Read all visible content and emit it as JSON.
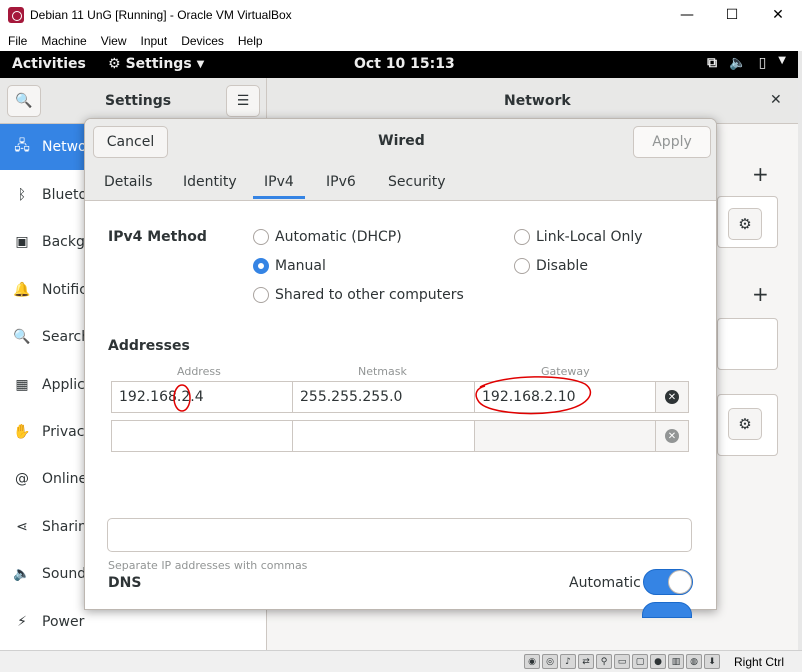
{
  "host": {
    "window_title": "Debian 11 UnG [Running] - Oracle VM VirtualBox",
    "controls": {
      "minimize": "—",
      "maximize": "☐",
      "close": "✕"
    },
    "menu": [
      "File",
      "Machine",
      "View",
      "Input",
      "Devices",
      "Help"
    ],
    "status_right": "Right Ctrl"
  },
  "gnome": {
    "activities": "Activities",
    "app_menu": "Settings",
    "clock": "Oct 10  15:13",
    "tray": [
      "network-icon",
      "volume-icon",
      "battery-icon",
      "power-menu-icon"
    ]
  },
  "settings": {
    "title": "Settings",
    "panel_title": "Network",
    "sidebar": [
      {
        "label": "Network",
        "icon": "network-icon",
        "active": true
      },
      {
        "label": "Bluetooth",
        "icon": "bluetooth-icon"
      },
      {
        "label": "Background",
        "icon": "background-icon"
      },
      {
        "label": "Notifications",
        "icon": "notifications-icon"
      },
      {
        "label": "Search",
        "icon": "search-icon"
      },
      {
        "label": "Applications",
        "icon": "applications-icon"
      },
      {
        "label": "Privacy",
        "icon": "privacy-icon"
      },
      {
        "label": "Online Accounts",
        "icon": "online-accounts-icon"
      },
      {
        "label": "Sharing",
        "icon": "sharing-icon"
      },
      {
        "label": "Sound",
        "icon": "sound-icon"
      },
      {
        "label": "Power",
        "icon": "power-icon"
      }
    ]
  },
  "dialog": {
    "cancel": "Cancel",
    "title": "Wired",
    "apply": "Apply",
    "tabs": [
      "Details",
      "Identity",
      "IPv4",
      "IPv6",
      "Security"
    ],
    "active_tab": "IPv4",
    "ipv4_method_label": "IPv4 Method",
    "methods": {
      "dhcp": "Automatic (DHCP)",
      "manual": "Manual",
      "shared": "Shared to other computers",
      "link_local": "Link-Local Only",
      "disable": "Disable"
    },
    "selected_method": "Manual",
    "addresses_label": "Addresses",
    "columns": [
      "Address",
      "Netmask",
      "Gateway"
    ],
    "rows": [
      {
        "address": "192.168.2.4",
        "netmask": "255.255.255.0",
        "gateway": "192.168.2.10"
      },
      {
        "address": "",
        "netmask": "",
        "gateway": ""
      }
    ],
    "dns_label": "DNS",
    "dns_automatic_label": "Automatic",
    "dns_automatic": true,
    "dns_value": "",
    "dns_hint": "Separate IP addresses with commas"
  }
}
